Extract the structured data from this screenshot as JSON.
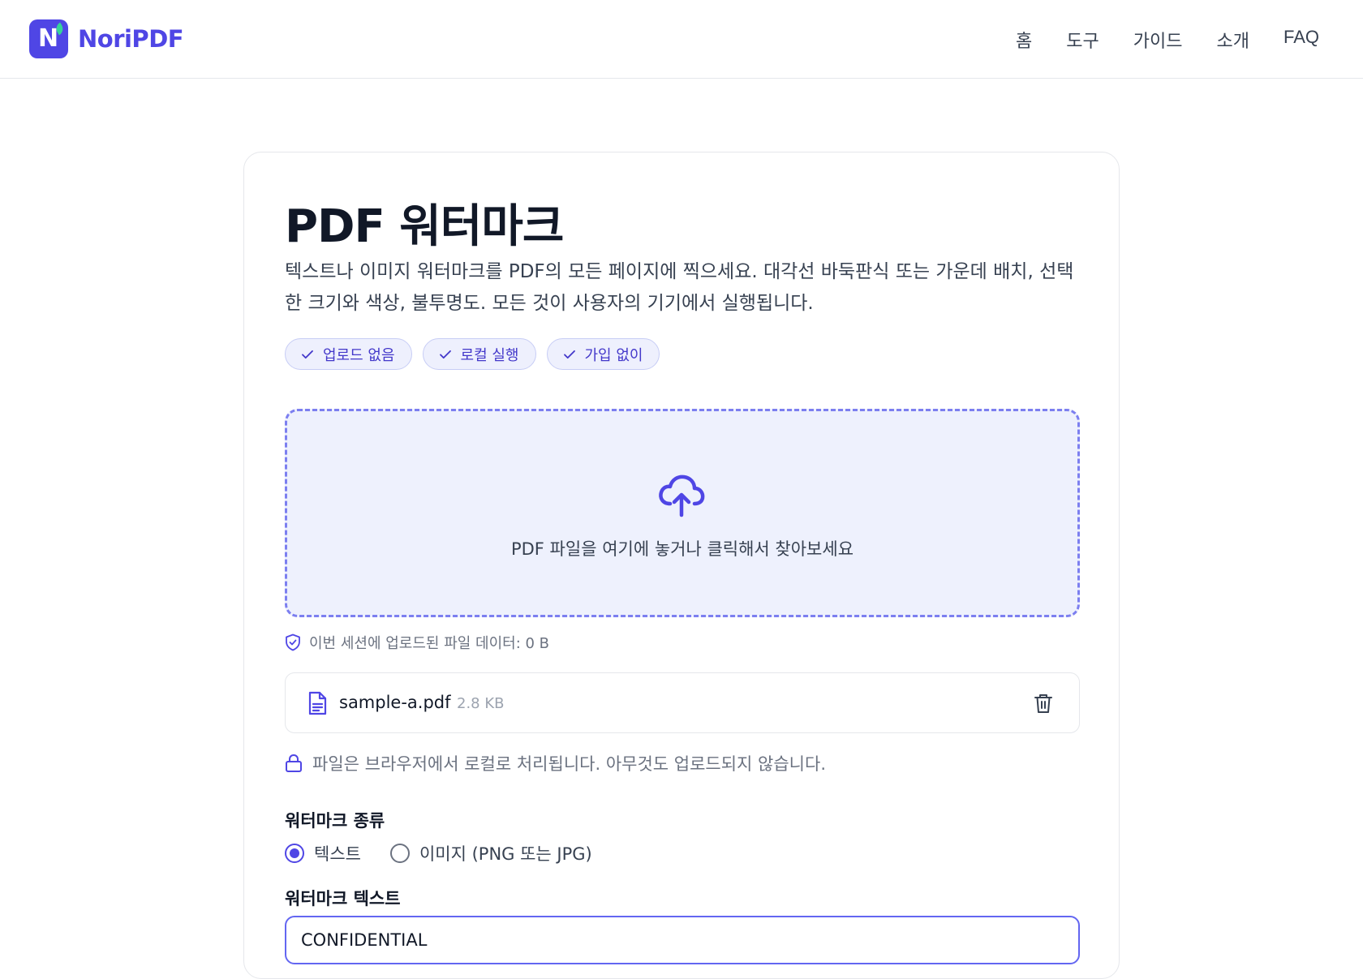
{
  "brand": {
    "logo_letter": "N",
    "name": "NoriPDF"
  },
  "nav": {
    "items": [
      "홈",
      "도구",
      "가이드",
      "소개",
      "FAQ"
    ]
  },
  "page": {
    "title": "PDF 워터마크",
    "description": "텍스트나 이미지 워터마크를 PDF의 모든 페이지에 찍으세요. 대각선 바둑판식 또는 가운데 배치, 선택한 크기와 색상, 불투명도. 모든 것이 사용자의 기기에서 실행됩니다.",
    "badges": [
      "업로드 없음",
      "로컬 실행",
      "가입 없이"
    ]
  },
  "dropzone": {
    "text": "PDF 파일을 여기에 놓거나 클릭해서 찾아보세요"
  },
  "session_note": "이번 세션에 업로드된 파일 데이터: 0 B",
  "file": {
    "name": "sample-a.pdf",
    "size": "2.8 KB"
  },
  "local_note": "파일은 브라우저에서 로컬로 처리됩니다. 아무것도 업로드되지 않습니다.",
  "watermark_type": {
    "label": "워터마크 종류",
    "options": [
      "텍스트",
      "이미지 (PNG 또는 JPG)"
    ],
    "selected": "텍스트"
  },
  "watermark_text": {
    "label": "워터마크 텍스트",
    "value": "CONFIDENTIAL"
  },
  "colors": {
    "accent": "#4f46e5",
    "badge_bg": "#eef0fd",
    "dropzone_bg": "#eef1fd",
    "leaf": "#34d399"
  }
}
